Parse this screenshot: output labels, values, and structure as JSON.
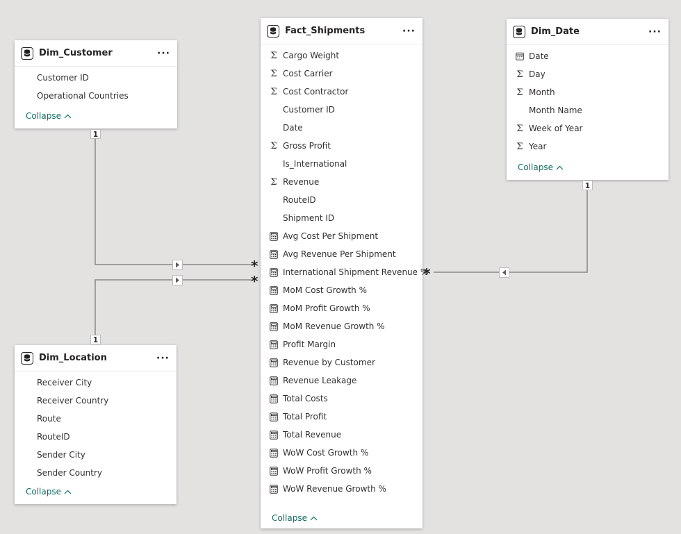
{
  "tables": {
    "dim_customer": {
      "title": "Dim_Customer",
      "fields": [
        {
          "label": "Customer ID",
          "icon": "none"
        },
        {
          "label": "Operational Countries",
          "icon": "none"
        }
      ],
      "collapse_label": "Collapse"
    },
    "fact_shipments": {
      "title": "Fact_Shipments",
      "fields": [
        {
          "label": "Cargo Weight",
          "icon": "sigma-icon"
        },
        {
          "label": "Cost Carrier",
          "icon": "sigma-icon"
        },
        {
          "label": "Cost Contractor",
          "icon": "sigma-icon"
        },
        {
          "label": "Customer ID",
          "icon": "none"
        },
        {
          "label": "Date",
          "icon": "none"
        },
        {
          "label": "Gross Profit",
          "icon": "sigma-icon"
        },
        {
          "label": "Is_International",
          "icon": "none"
        },
        {
          "label": "Revenue",
          "icon": "sigma-icon"
        },
        {
          "label": "RouteID",
          "icon": "none"
        },
        {
          "label": "Shipment ID",
          "icon": "none"
        },
        {
          "label": "Avg Cost Per Shipment",
          "icon": "calculator-icon"
        },
        {
          "label": "Avg Revenue Per Shipment",
          "icon": "calculator-icon"
        },
        {
          "label": "International Shipment Revenue %",
          "icon": "calculator-icon"
        },
        {
          "label": "MoM Cost Growth %",
          "icon": "calculator-icon"
        },
        {
          "label": "MoM Profit Growth %",
          "icon": "calculator-icon"
        },
        {
          "label": "MoM Revenue Growth %",
          "icon": "calculator-icon"
        },
        {
          "label": "Profit Margin",
          "icon": "calculator-icon"
        },
        {
          "label": "Revenue by Customer",
          "icon": "calculator-icon"
        },
        {
          "label": "Revenue Leakage",
          "icon": "calculator-icon"
        },
        {
          "label": "Total Costs",
          "icon": "calculator-icon"
        },
        {
          "label": "Total Profit",
          "icon": "calculator-icon"
        },
        {
          "label": "Total Revenue",
          "icon": "calculator-icon"
        },
        {
          "label": "WoW Cost Growth %",
          "icon": "calculator-icon"
        },
        {
          "label": "WoW Profit Growth %",
          "icon": "calculator-icon"
        },
        {
          "label": "WoW Revenue Growth %",
          "icon": "calculator-icon"
        }
      ],
      "collapse_label": "Collapse"
    },
    "dim_date": {
      "title": "Dim_Date",
      "fields": [
        {
          "label": "Date",
          "icon": "calendar-icon"
        },
        {
          "label": "Day",
          "icon": "sigma-icon"
        },
        {
          "label": "Month",
          "icon": "sigma-icon"
        },
        {
          "label": "Month Name",
          "icon": "none"
        },
        {
          "label": "Week of Year",
          "icon": "sigma-icon"
        },
        {
          "label": "Year",
          "icon": "sigma-icon"
        }
      ],
      "collapse_label": "Collapse"
    },
    "dim_location": {
      "title": "Dim_Location",
      "fields": [
        {
          "label": "Receiver City",
          "icon": "none"
        },
        {
          "label": "Receiver Country",
          "icon": "none"
        },
        {
          "label": "Route",
          "icon": "none"
        },
        {
          "label": "RouteID",
          "icon": "none"
        },
        {
          "label": "Sender City",
          "icon": "none"
        },
        {
          "label": "Sender Country",
          "icon": "none"
        }
      ],
      "collapse_label": "Collapse"
    }
  },
  "relationships": {
    "customer_one": "1",
    "location_one": "1",
    "date_one": "1",
    "many_symbol": "*"
  },
  "colors": {
    "canvas": "#e3e2e1",
    "link": "#106c61",
    "line": "#8a8886"
  }
}
